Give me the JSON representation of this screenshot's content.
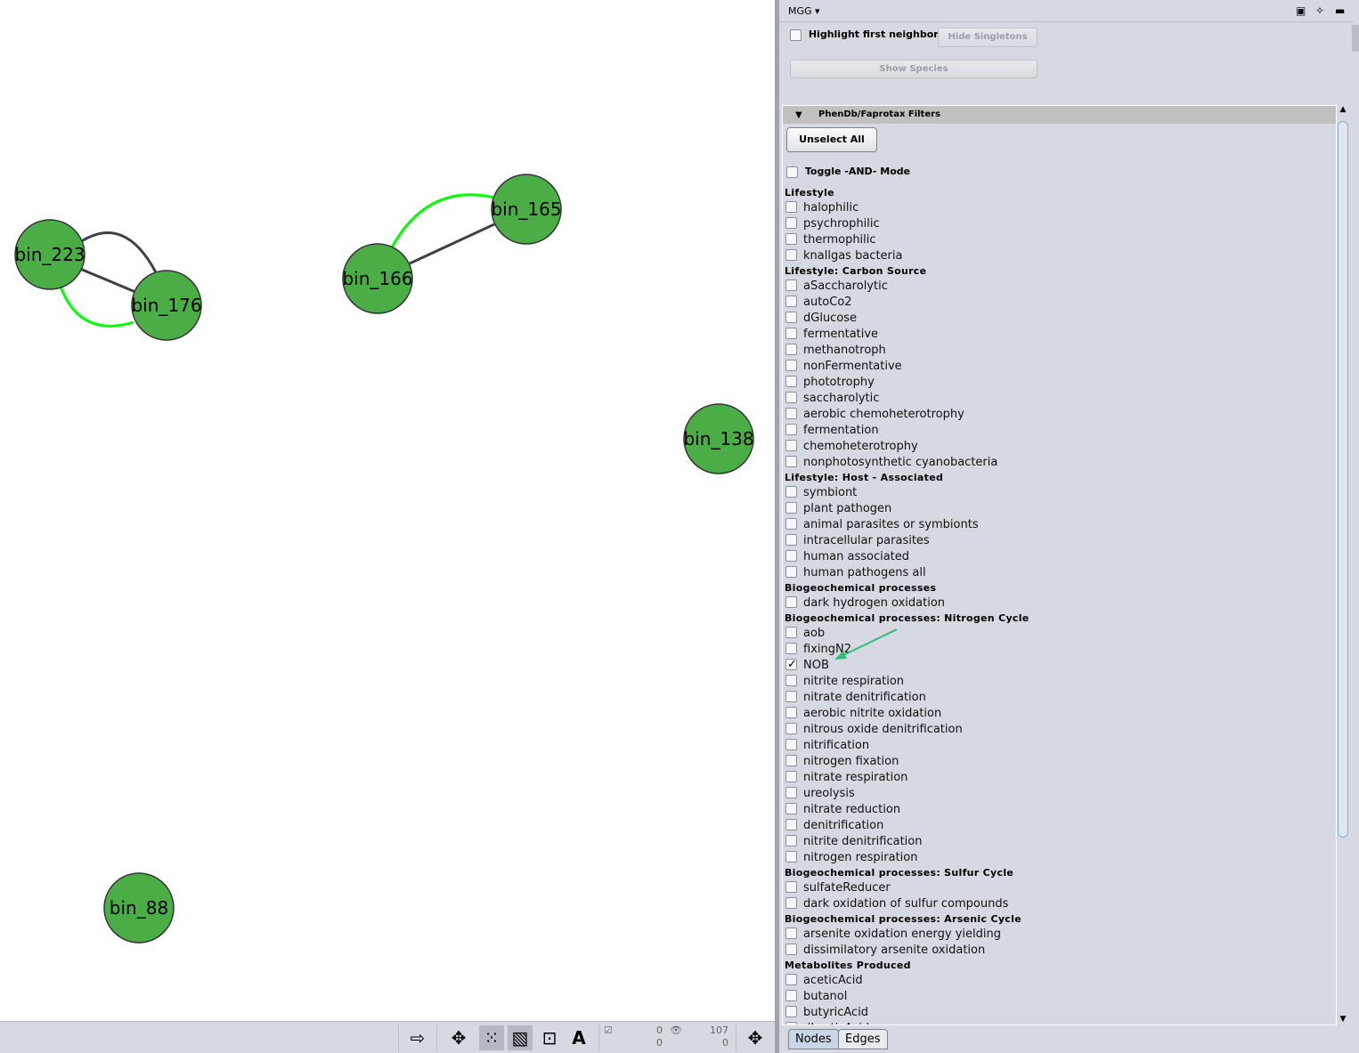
{
  "network": {
    "nodes": [
      {
        "id": "bin_223"
      },
      {
        "id": "bin_176"
      },
      {
        "id": "bin_166"
      },
      {
        "id": "bin_165"
      },
      {
        "id": "bin_138"
      },
      {
        "id": "bin_88"
      }
    ],
    "edges": [
      {
        "source": "bin_223",
        "target": "bin_176",
        "color": "#404040"
      },
      {
        "source": "bin_223",
        "target": "bin_176",
        "color": "#404040"
      },
      {
        "source": "bin_223",
        "target": "bin_176",
        "color": "#00ff00"
      },
      {
        "source": "bin_166",
        "target": "bin_165",
        "color": "#404040"
      },
      {
        "source": "bin_166",
        "target": "bin_165",
        "color": "#00ff00"
      }
    ],
    "node_color": "#4aad46"
  },
  "toolbar": {
    "selected_nodes": "0",
    "selected_edges": "0",
    "hidden_nodes": "107",
    "hidden_edges": "0"
  },
  "panel": {
    "title": "MGG ▾",
    "highlight_label": "Highlight first neighbors",
    "hide_singletons": "Hide Singletons",
    "show_species": "Show Species",
    "filters_title": "PhenDb/Faprotax Filters",
    "unselect_all": "Unselect All",
    "and_mode": "Toggle -AND- Mode",
    "groups": [
      {
        "header": "Lifestyle",
        "items": [
          "halophilic",
          "psychrophilic",
          "thermophilic",
          "knallgas bacteria"
        ]
      },
      {
        "header": "Lifestyle: Carbon Source",
        "items": [
          "aSaccharolytic",
          "autoCo2",
          "dGlucose",
          "fermentative",
          "methanotroph",
          "nonFermentative",
          "phototrophy",
          "saccharolytic",
          "aerobic chemoheterotrophy",
          "fermentation",
          "chemoheterotrophy",
          "nonphotosynthetic cyanobacteria"
        ]
      },
      {
        "header": "Lifestyle: Host - Associated",
        "items": [
          "symbiont",
          "plant pathogen",
          "animal parasites or symbionts",
          "intracellular parasites",
          "human associated",
          "human pathogens all"
        ]
      },
      {
        "header": "Biogeochemical processes",
        "items": [
          "dark hydrogen oxidation"
        ]
      },
      {
        "header": "Biogeochemical processes: Nitrogen Cycle",
        "items": [
          "aob",
          "fixingN2",
          "NOB",
          "nitrite respiration",
          "nitrate denitrification",
          "aerobic nitrite oxidation",
          "nitrous oxide denitrification",
          "nitrification",
          "nitrogen fixation",
          "nitrate respiration",
          "ureolysis",
          "nitrate reduction",
          "denitrification",
          "nitrite denitrification",
          "nitrogen respiration"
        ]
      },
      {
        "header": "Biogeochemical processes: Sulfur Cycle",
        "items": [
          "sulfateReducer",
          "dark oxidation of sulfur compounds"
        ]
      },
      {
        "header": "Biogeochemical processes: Arsenic Cycle",
        "items": [
          "arsenite oxidation energy yielding",
          "dissimilatory arsenite oxidation"
        ]
      },
      {
        "header": "Metabolites Produced",
        "items": [
          "aceticAcid",
          "butanol",
          "butyricAcid",
          "dLacticAcid"
        ]
      }
    ],
    "checked": [
      "NOB"
    ],
    "tabs": [
      "Nodes",
      "Edges"
    ],
    "active_tab": "Nodes",
    "annotation_arrow_color": "#2ebd7a"
  }
}
